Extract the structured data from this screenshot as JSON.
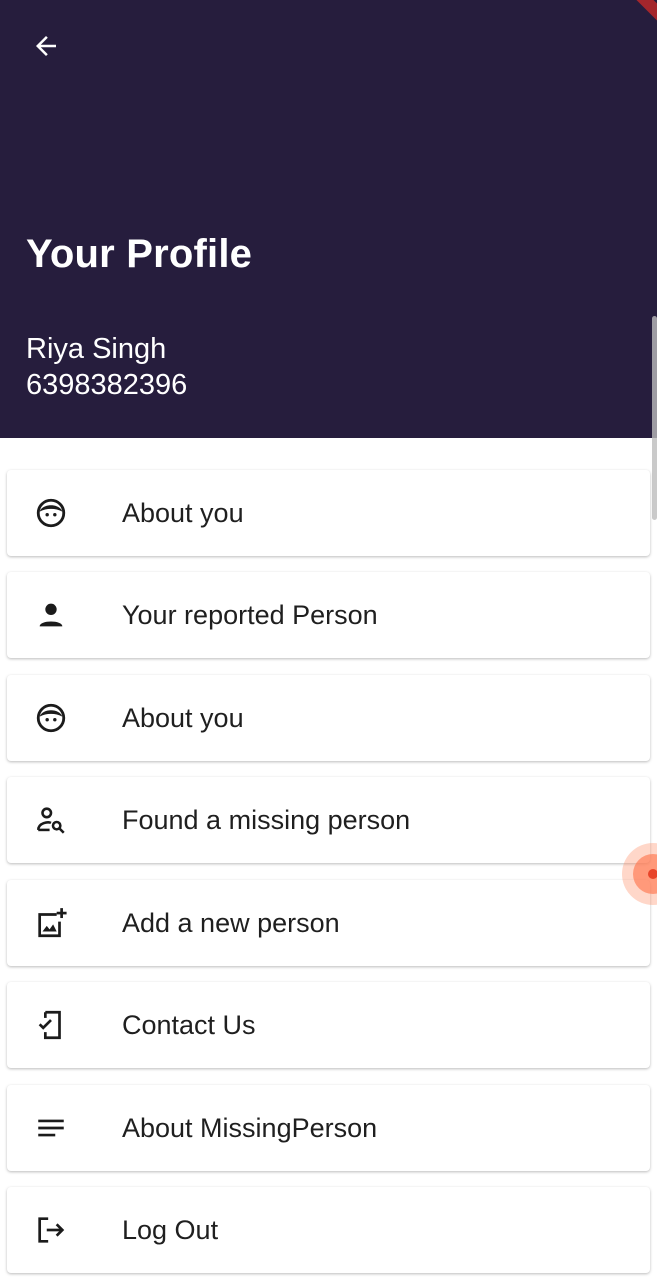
{
  "header": {
    "title": "Your Profile",
    "user_name": "Riya Singh",
    "user_phone": "6398382396",
    "background_color": "#261d3d",
    "back_icon": "arrow-back-icon"
  },
  "menu": {
    "items": [
      {
        "label": "About you",
        "icon": "face-icon"
      },
      {
        "label": "Your reported Person",
        "icon": "person-icon"
      },
      {
        "label": "About you",
        "icon": "face-icon"
      },
      {
        "label": "Found a missing person",
        "icon": "person-search-icon"
      },
      {
        "label": "Add a new person",
        "icon": "add-photo-icon"
      },
      {
        "label": "Contact Us",
        "icon": "mobile-check-icon"
      },
      {
        "label": "About MissingPerson",
        "icon": "notes-icon"
      },
      {
        "label": "Log Out",
        "icon": "logout-icon"
      }
    ]
  }
}
